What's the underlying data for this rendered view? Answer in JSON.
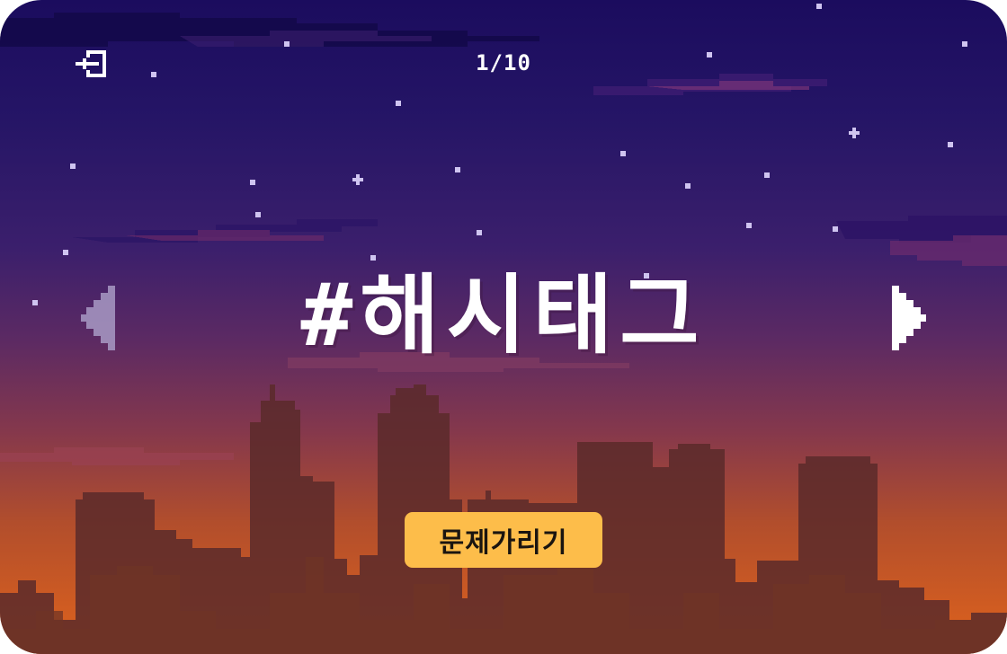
{
  "game": {
    "progress": "1/10",
    "word": "#해시태그",
    "hide_button_label": "문제가리기"
  },
  "icons": {
    "exit": "exit-icon",
    "prev": "prev-arrow-icon",
    "next": "next-arrow-icon"
  },
  "colors": {
    "sky_top": "#1b0c5e",
    "sky_bottom": "#e0631c",
    "button": "#fdbd4a",
    "text": "#ffffff"
  }
}
